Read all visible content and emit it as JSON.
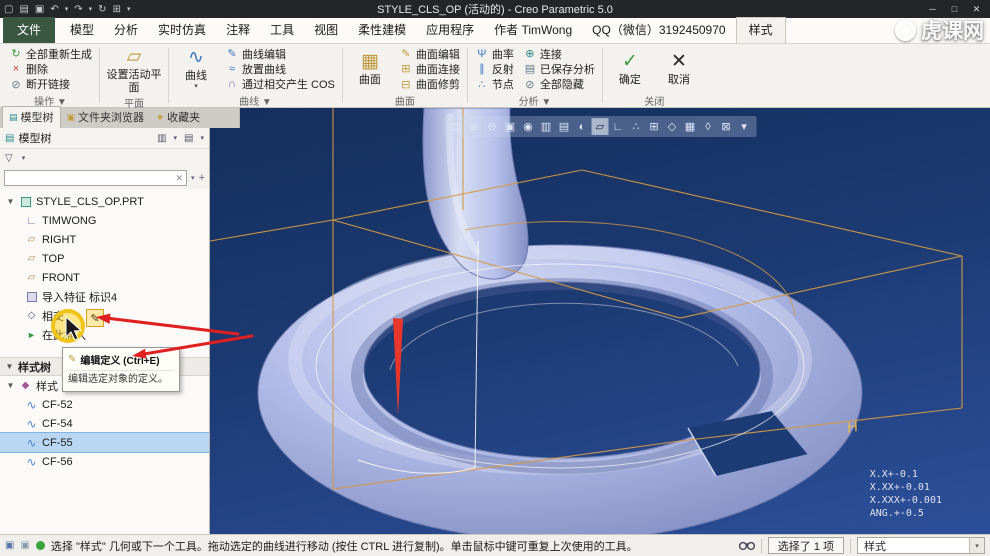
{
  "window": {
    "title": "STYLE_CLS_OP (活动的) - Creo Parametric 5.0",
    "controls": {
      "minimize": "─",
      "maximize": "□",
      "close": "✕"
    }
  },
  "titlebar_icons": [
    "▢",
    "▤",
    "▣",
    "↶",
    "▾",
    "↷",
    "▾",
    "↻",
    "⊞",
    "▾"
  ],
  "menu": {
    "tabs": [
      "文件",
      "模型",
      "分析",
      "实时仿真",
      "注释",
      "工具",
      "视图",
      "柔性建模",
      "应用程序",
      "作者 TimWong",
      "QQ（微信）3192450970",
      "样式"
    ]
  },
  "glyphs": {
    "caret": "▾",
    "caret_down": "▼",
    "regenerate": "↻",
    "delete": "×",
    "break_link": "⊘",
    "active_plane": "▱",
    "curve": "∿",
    "curve_edit": "✎",
    "placed_curve": "≈",
    "cos_curve": "∩",
    "surface": "▦",
    "surface_edit": "✎",
    "surface_connect": "⊞",
    "surface_trim": "⊟",
    "curvature": "Ψ",
    "reflect": "∥",
    "node": "∴",
    "connect": "⊕",
    "saved_analysis": "▤",
    "hide_all": "⊘",
    "ok": "✓",
    "cancel": "✕",
    "model_tree_tab": "▤",
    "folder_tab": "▣",
    "favorites_tab": "★",
    "tree_icon": "▤",
    "columns_icon": "▥",
    "docs_icon": "▤",
    "funnel": "▽",
    "clear": "✕",
    "plus": "+",
    "csys": "∟",
    "plane": "▱",
    "intersect": "◇",
    "insert": "►",
    "style": "◆",
    "cf": "∿",
    "edit_def": "✎",
    "window_small": "▣"
  },
  "ribbon": {
    "operations": {
      "label": "操作 ▼",
      "buttons": [
        "全部重新生成",
        "删除",
        "断开链接"
      ]
    },
    "plane": {
      "label": "平面",
      "button": "设置活动平面"
    },
    "curve": {
      "label": "曲线 ▼",
      "big": "曲线",
      "buttons": [
        "曲线编辑",
        "放置曲线",
        "通过相交产生 COS"
      ]
    },
    "surface": {
      "label": "曲面",
      "big": "曲面",
      "buttons": [
        "曲面编辑",
        "曲面连接",
        "曲面修剪"
      ]
    },
    "analysis": {
      "label": "分析 ▼",
      "col1": [
        "曲率",
        "反射",
        "节点"
      ],
      "col2": [
        "连接",
        "已保存分析",
        "全部隐藏"
      ]
    },
    "close": {
      "label": "关闭",
      "ok": "确定",
      "cancel": "取消"
    }
  },
  "panel_tabs": [
    "模型树",
    "文件夹浏览器",
    "收藏夹"
  ],
  "model_tree": {
    "header": "模型树",
    "root": "STYLE_CLS_OP.PRT",
    "items": [
      "TIMWONG",
      "RIGHT",
      "TOP",
      "FRONT",
      "导入特征 标识4",
      "相交",
      "在此插入"
    ]
  },
  "style_tree": {
    "header": "样式树",
    "style_item": "样式 1",
    "items": [
      "CF-52",
      "CF-54",
      "CF-55",
      "CF-56"
    ],
    "selected_item": "CF-55"
  },
  "search": {
    "value": ""
  },
  "context_menu": {
    "title": "编辑定义 (Ctrl+E)",
    "description": "编辑选定对象的定义。"
  },
  "vt_icons": [
    {
      "name": "refit-icon",
      "glyph": "⊡"
    },
    {
      "name": "zoom-in-icon",
      "glyph": "⊕"
    },
    {
      "name": "zoom-out-icon",
      "glyph": "⊖"
    },
    {
      "name": "repaint-icon",
      "glyph": "▣"
    },
    {
      "name": "spin-center-icon",
      "glyph": "◉"
    },
    {
      "name": "display-style-icon",
      "glyph": "▥"
    },
    {
      "name": "hidden-line-icon",
      "glyph": "▤"
    },
    {
      "name": "shaded-view-icon",
      "glyph": "◐"
    },
    {
      "name": "datum-plane-display-icon",
      "glyph": "▱"
    },
    {
      "name": "datum-axis-display-icon",
      "glyph": "∟"
    },
    {
      "name": "datum-point-display-icon",
      "glyph": "∴"
    },
    {
      "name": "csys-display-icon",
      "glyph": "⊞"
    },
    {
      "name": "annotation-display-icon",
      "glyph": "◇"
    },
    {
      "name": "view-manager-icon",
      "glyph": "▦"
    },
    {
      "name": "perspective-icon",
      "glyph": "◊"
    },
    {
      "name": "clip-icon",
      "glyph": "⊠"
    },
    {
      "name": "more-views-icon",
      "glyph": "▾"
    }
  ],
  "viewport": {
    "tolerances": [
      "X.X+-0.1",
      "X.XX+-0.01",
      "X.XXX+-0.001",
      "ANG.+-0.5"
    ],
    "datum_tag": "H"
  },
  "statusbar": {
    "message": "选择 \"样式\" 几何或下一个工具。拖动选定的曲线进行移动 (按住 CTRL 进行复制)。单击鼠标中键可重复上次使用的工具。",
    "selection": "选择了 1 项",
    "filter": "样式"
  },
  "watermark": "虎课网"
}
